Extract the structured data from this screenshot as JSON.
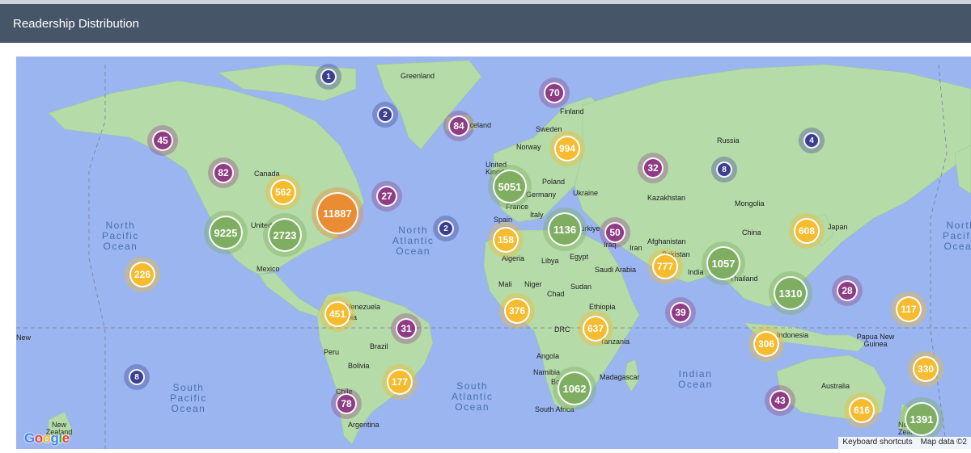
{
  "header": {
    "title": "Readership Distribution"
  },
  "colors": {
    "header_bg": "#475569",
    "ocean": "#9ab5ef",
    "land": "#a8d5a2",
    "navy": "#3a3f8f",
    "purple": "#8e3c84",
    "yellow": "#f6bb2f",
    "green": "#7fae62",
    "orange": "#ea8c34"
  },
  "map": {
    "place_labels": [
      "Greenland",
      "Finland",
      "Sweden",
      "Norway",
      "United Kingdom",
      "Poland",
      "Germany",
      "Ukraine",
      "France",
      "Italy",
      "Spain",
      "Türkiye",
      "Russia",
      "Kazakhstan",
      "Mongolia",
      "China",
      "Japan",
      "Afghanistan",
      "Iran",
      "Iraq",
      "Pakistan",
      "India",
      "Thailand",
      "Saudi Arabia",
      "Egypt",
      "Libya",
      "Algeria",
      "Mali",
      "Niger",
      "Chad",
      "Sudan",
      "Ethiopia",
      "DRC",
      "Tanzania",
      "Angola",
      "Namibia",
      "Botswana",
      "Madagascar",
      "South Africa",
      "Canada",
      "United States",
      "Mexico",
      "Venezuela",
      "Colombia",
      "Peru",
      "Brazil",
      "Bolivia",
      "Chile",
      "Argentina",
      "Indonesia",
      "Papua New Guinea",
      "Australia",
      "New Zealand",
      "New Zealand",
      "Iceland"
    ],
    "oceans": [
      "North\nPacific\nOcean",
      "North\nAtlantic\nOcean",
      "South\nPacific\nOcean",
      "South\nAtlantic\nOcean",
      "Indian\nOcean",
      "North\nPacific\nOcean"
    ],
    "logo": "Google",
    "attribution": {
      "shortcuts": "Keyboard shortcuts",
      "data": "Map data ©2"
    }
  },
  "clusters": [
    {
      "label": "1",
      "color": "navy"
    },
    {
      "label": "2",
      "color": "navy"
    },
    {
      "label": "84",
      "color": "purple"
    },
    {
      "label": "70",
      "color": "purple"
    },
    {
      "label": "45",
      "color": "purple"
    },
    {
      "label": "82",
      "color": "purple"
    },
    {
      "label": "562",
      "color": "yellow"
    },
    {
      "label": "27",
      "color": "purple"
    },
    {
      "label": "11887",
      "color": "orange"
    },
    {
      "label": "9225",
      "color": "green"
    },
    {
      "label": "2723",
      "color": "green"
    },
    {
      "label": "2",
      "color": "navy"
    },
    {
      "label": "226",
      "color": "yellow"
    },
    {
      "label": "994",
      "color": "yellow"
    },
    {
      "label": "5051",
      "color": "green"
    },
    {
      "label": "32",
      "color": "purple"
    },
    {
      "label": "8",
      "color": "navy"
    },
    {
      "label": "4",
      "color": "navy"
    },
    {
      "label": "158",
      "color": "yellow"
    },
    {
      "label": "1136",
      "color": "green"
    },
    {
      "label": "50",
      "color": "purple"
    },
    {
      "label": "777",
      "color": "yellow"
    },
    {
      "label": "1057",
      "color": "green"
    },
    {
      "label": "608",
      "color": "yellow"
    },
    {
      "label": "1310",
      "color": "green"
    },
    {
      "label": "28",
      "color": "purple"
    },
    {
      "label": "117",
      "color": "yellow"
    },
    {
      "label": "451",
      "color": "yellow"
    },
    {
      "label": "31",
      "color": "purple"
    },
    {
      "label": "376",
      "color": "yellow"
    },
    {
      "label": "39",
      "color": "purple"
    },
    {
      "label": "637",
      "color": "yellow"
    },
    {
      "label": "306",
      "color": "yellow"
    },
    {
      "label": "8",
      "color": "navy"
    },
    {
      "label": "177",
      "color": "yellow"
    },
    {
      "label": "1062",
      "color": "green"
    },
    {
      "label": "78",
      "color": "purple"
    },
    {
      "label": "43",
      "color": "purple"
    },
    {
      "label": "330",
      "color": "yellow"
    },
    {
      "label": "616",
      "color": "yellow"
    },
    {
      "label": "1391",
      "color": "green"
    }
  ]
}
